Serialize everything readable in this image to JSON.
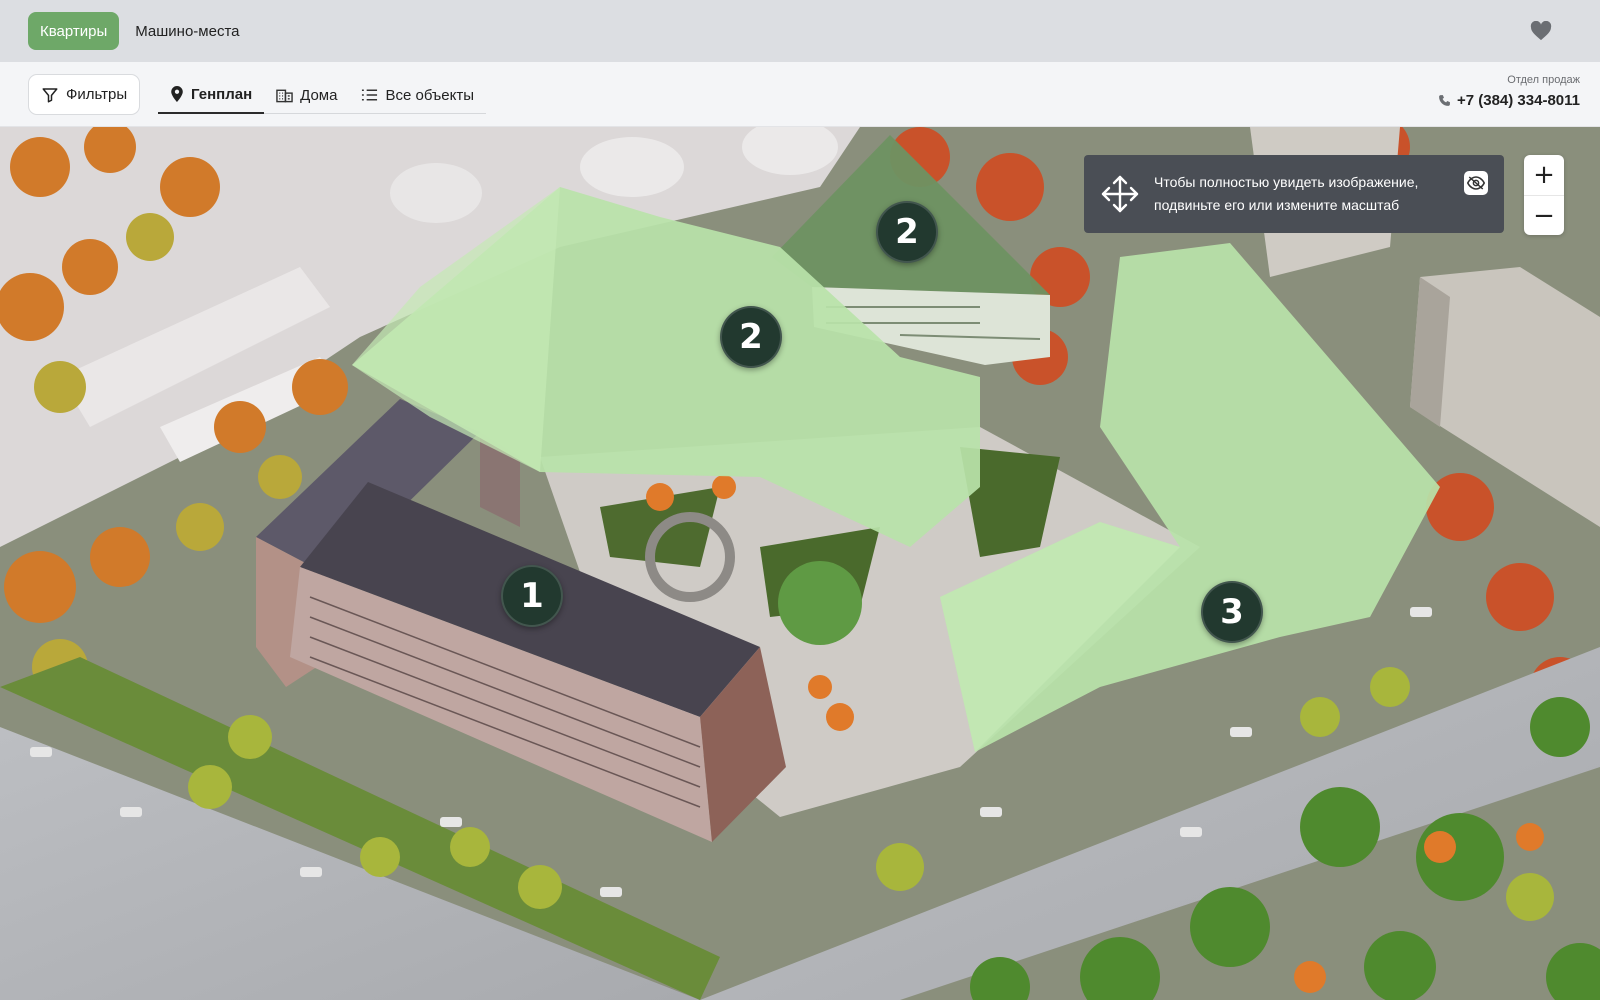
{
  "topbar": {
    "tabs": [
      {
        "label": "Квартиры",
        "active": true
      },
      {
        "label": "Машино-места",
        "active": false
      }
    ],
    "favorites_icon": "heart-icon"
  },
  "toolbar": {
    "filter_label": "Фильтры",
    "views": [
      {
        "label": "Генплан",
        "icon": "pin-icon",
        "active": true
      },
      {
        "label": "Дома",
        "icon": "building-icon",
        "active": false
      },
      {
        "label": "Все объекты",
        "icon": "list-icon",
        "active": false
      }
    ],
    "sales_label": "Отдел продаж",
    "phone": "+7 (384) 334-8011"
  },
  "map": {
    "hint_text": "Чтобы полностью увидеть изображение, подвиньте его или измените масштаб",
    "zoom_in": "+",
    "zoom_out": "−",
    "markers": [
      "1",
      "2",
      "2",
      "3"
    ]
  },
  "colors": {
    "accent": "#6ea868",
    "marker": "#22392f",
    "building_overlay": "#b6e3a6",
    "hint_bg": "#4a4e55"
  }
}
